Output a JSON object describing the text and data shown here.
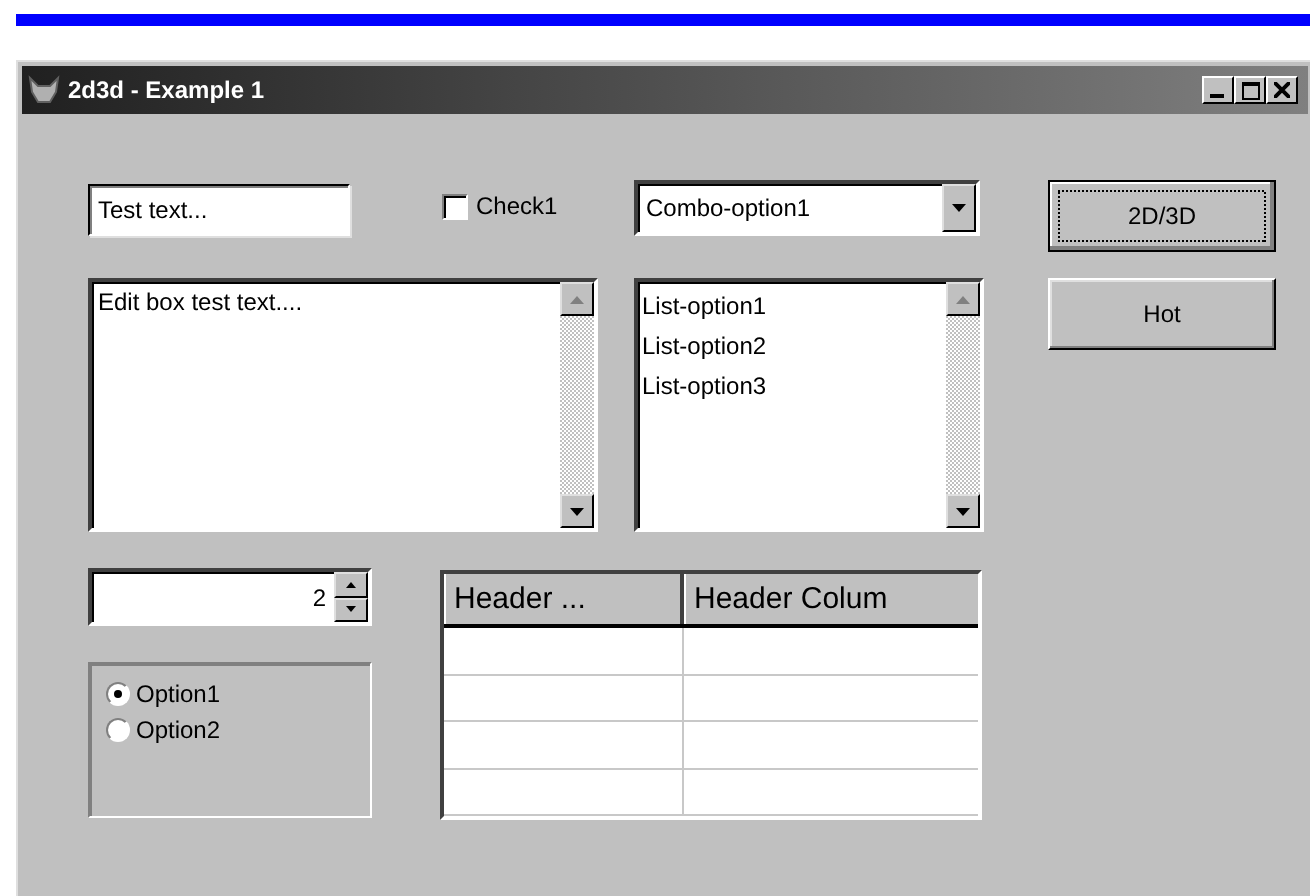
{
  "window": {
    "title": "2d3d - Example 1"
  },
  "text_field": {
    "value": "Test text..."
  },
  "checkbox": {
    "label": "Check1",
    "checked": false
  },
  "combo": {
    "value": "Combo-option1"
  },
  "buttons": [
    {
      "label": "2D/3D",
      "focused": true
    },
    {
      "label": "Hot",
      "focused": false
    }
  ],
  "edit_box": {
    "value": "Edit box test text...."
  },
  "list": {
    "items": [
      {
        "label": "List-option1",
        "selected": false
      },
      {
        "label": "List-option2",
        "selected": false
      },
      {
        "label": "List-option3",
        "selected": false
      }
    ]
  },
  "spin": {
    "value": "2"
  },
  "radios": [
    {
      "label": "Option1",
      "selected": true
    },
    {
      "label": "Option2",
      "selected": false
    }
  ],
  "table": {
    "columns": [
      "Header ...",
      "Header Colum"
    ]
  }
}
